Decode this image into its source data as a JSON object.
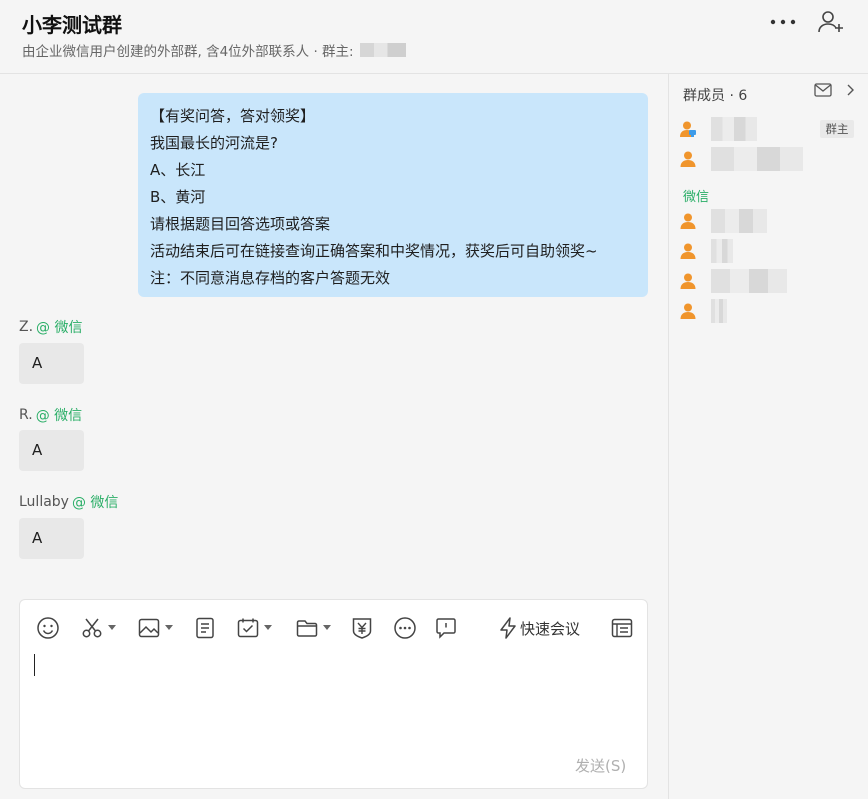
{
  "header": {
    "title": "小李测试群",
    "subtitle": "由企业微信用户创建的外部群, 含4位外部联系人 · 群主:"
  },
  "chat": {
    "announcement_lines": [
      "【有奖问答，答对领奖】",
      "我国最长的河流是?",
      "A、长江",
      "B、黄河",
      "请根据题目回答选项或答案",
      "活动结束后可在链接查询正确答案和中奖情况，获奖后可自助领奖~",
      "注：不同意消息存档的客户答题无效"
    ],
    "replies": [
      {
        "sender": "Z.",
        "tag": "@ 微信",
        "text": "A"
      },
      {
        "sender": "R.",
        "tag": "@ 微信",
        "text": "A"
      },
      {
        "sender": "Lullaby",
        "tag": "@ 微信",
        "text": "A"
      }
    ]
  },
  "sidebar": {
    "members_title": "群成员 · 6",
    "owner_badge": "群主",
    "section_wechat": "微信"
  },
  "input": {
    "quick_meeting_label": "快速会议",
    "send_label": "发送(S)"
  },
  "colors": {
    "announcement_bg": "#c9e6fb",
    "wechat_green": "#2aae67",
    "avatar_orange": "#f0952c"
  }
}
